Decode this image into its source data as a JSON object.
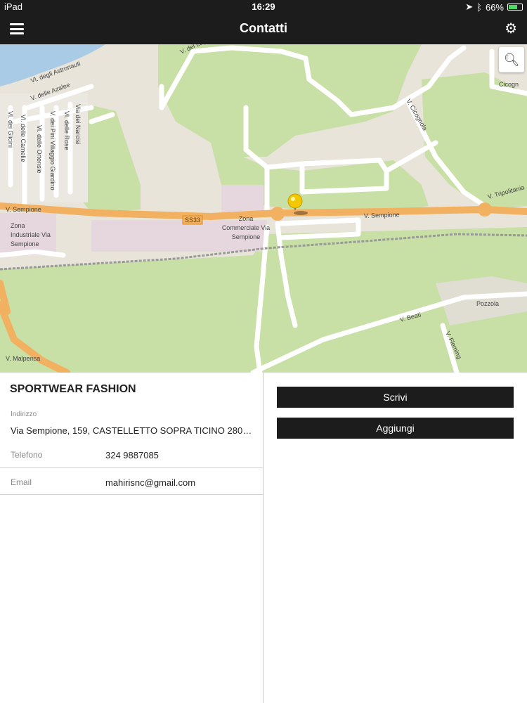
{
  "status_bar": {
    "device": "iPad",
    "time": "16:29",
    "battery": "66%",
    "battery_level": 0.66
  },
  "header": {
    "title": "Contatti",
    "menu_icon": "hamburger-icon",
    "settings_icon": "gear-icon"
  },
  "map": {
    "zoom_icon": "magnifier-icon",
    "labels": {
      "v_del_lago": "V. del Lago",
      "vl_astronauti": "Vl. degli Astronauti",
      "v_azalee": "V. delle Azalee",
      "cicogn": "Cicogn",
      "v_cicognola": "V. Cicognola",
      "vl_glicini": "Vl. dei Glicini",
      "vl_camelie": "Vl. delle Camelie",
      "vl_ortensie": "Vl. delle Ortensie",
      "v_pini": "V. dei Pini Villaggio Giardino",
      "vl_rose": "Vl. delle Rose",
      "via_narcisi": "Via dei Narcisi",
      "v_tripolitania": "V. Tripolitania",
      "v_sempione_left": "V. Sempione",
      "ss33": "SS33",
      "v_sempione_right": "V. Sempione",
      "zona_industriale": "Zona Industriale Via Sempione",
      "zona_commerciale": "Zona Commerciale Via Sempione",
      "v_malpensa": "V. Malpensa",
      "v_beati": "V. Beati",
      "pozzola": "Pozzola",
      "v_fleming": "V. Fleming"
    }
  },
  "contact": {
    "company": "SPORTWEAR FASHION",
    "address_label": "Indirizzo",
    "address_value": "Via Sempione, 159, CASTELLETTO SOPRA TICINO 280…",
    "phone_label": "Telefono",
    "phone_value": "324 9887085",
    "email_label": "Email",
    "email_value": "mahirisnc@gmail.com"
  },
  "actions": {
    "write_label": "Scrivi",
    "add_label": "Aggiungi"
  },
  "colors": {
    "bar_bg": "#1c1c1c",
    "map_green": "#c8dfa5",
    "map_land": "#e8e4da",
    "road_orange": "#f2b160",
    "water": "#a9cbe6"
  }
}
